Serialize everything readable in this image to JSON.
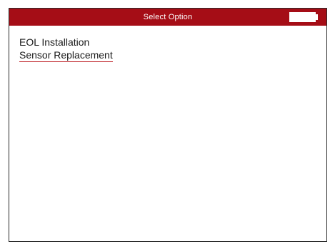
{
  "window": {
    "title": "Select Option"
  },
  "status": {
    "battery_icon": "battery-icon"
  },
  "menu": {
    "items": [
      {
        "label": "EOL Installation",
        "selected": false
      },
      {
        "label": "Sensor Replacement",
        "selected": true
      }
    ]
  },
  "colors": {
    "title_bar": "#a50d16",
    "selection_underline": "#c0272d",
    "text": "#1a1a1a"
  }
}
